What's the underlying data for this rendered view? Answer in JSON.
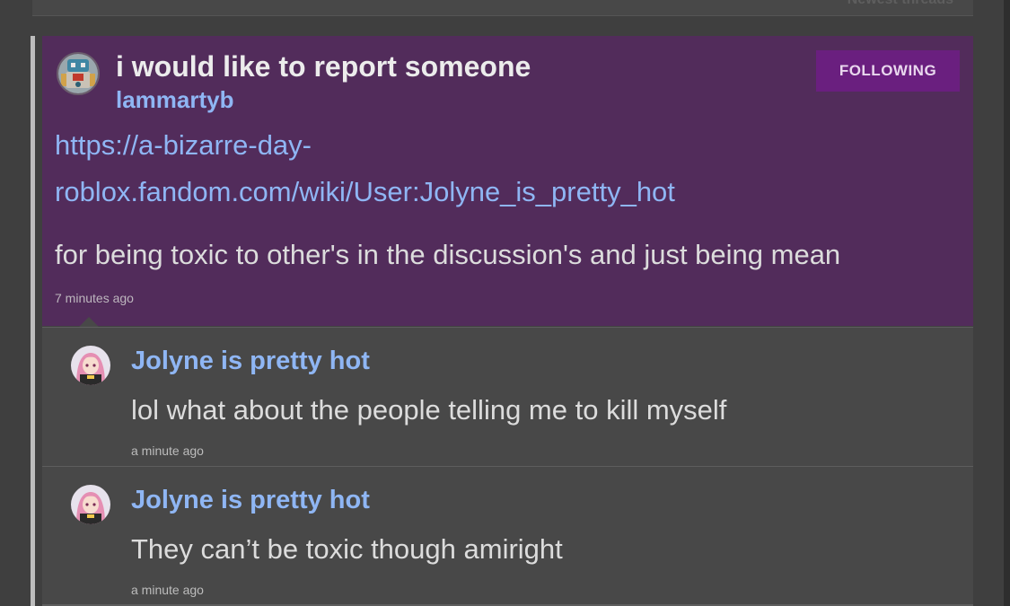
{
  "header": {
    "newest_threads_label": "Newest threads"
  },
  "thread": {
    "title": "i would like to report someone",
    "author": "lammartyb",
    "follow_label": "FOLLOWING",
    "link_line1": "https://a-bizarre-day-",
    "link_line2": "roblox.fandom.com/wiki/User:Jolyne_is_pretty_hot",
    "body": "for being toxic to other's in the discussion's and just being mean",
    "time": "7 minutes ago",
    "avatar_icon": "robot-avatar-icon",
    "background_color": "#522c5b",
    "follow_color": "#6a1f7f"
  },
  "replies": [
    {
      "author": "Jolyne is pretty hot",
      "text": "lol what about the people telling me to kill myself",
      "time": "a minute ago",
      "avatar_icon": "anime-girl-avatar-icon"
    },
    {
      "author": "Jolyne is pretty hot",
      "text": "They can’t be toxic though amiright",
      "time": "a minute ago",
      "avatar_icon": "anime-girl-avatar-icon"
    }
  ],
  "colors": {
    "link": "#8fb6f4",
    "page_background": "#3f3f3f",
    "reply_background": "#484848"
  }
}
